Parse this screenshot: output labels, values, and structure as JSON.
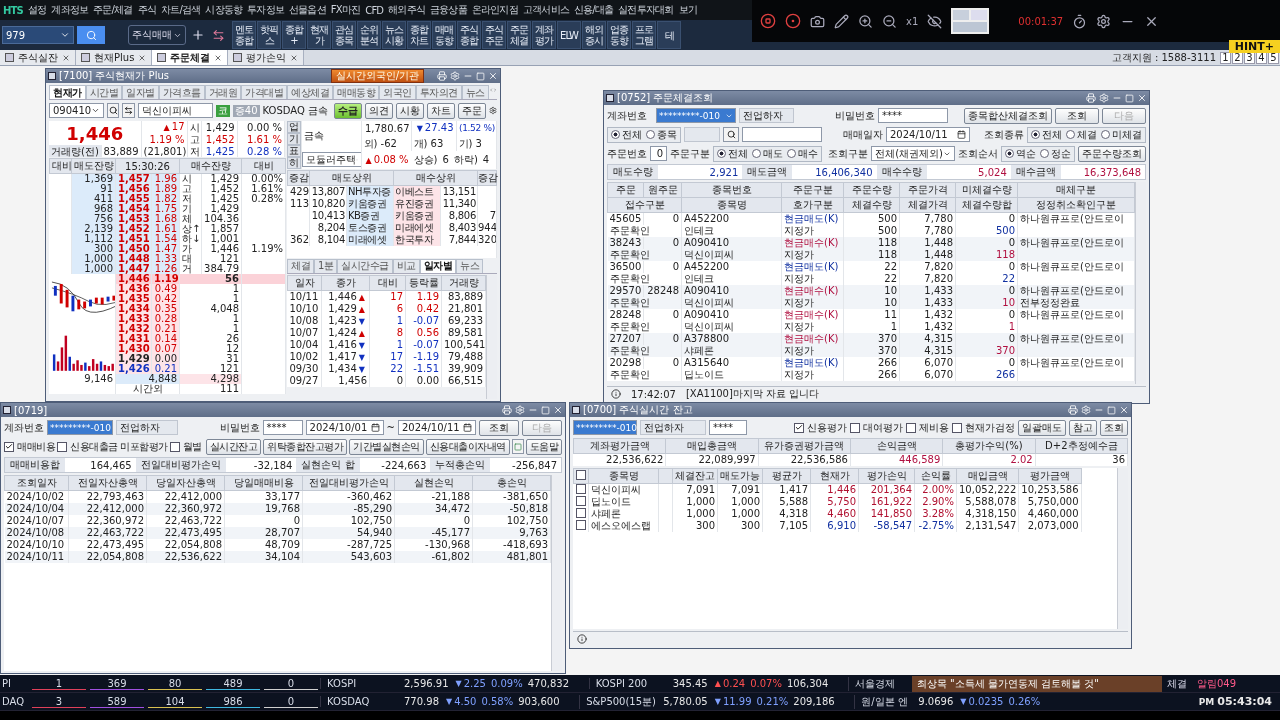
{
  "app": {
    "logo": "HTS"
  },
  "menu": [
    "설정",
    "계좌정보",
    "주문/체결",
    "주식",
    "차트/검색",
    "시장동향",
    "투자정보",
    "선물옵션",
    "FX마진",
    "CFD",
    "해외주식",
    "금융상품",
    "온라인지점",
    "고객서비스",
    "신용/대출",
    "실전투자대회",
    "보기"
  ],
  "recorder": {
    "zoom": "x1",
    "time": "00:01:37",
    "banner": "HINT+"
  },
  "toolbar": {
    "account": "979",
    "screen": "주식매매",
    "buttons": [
      "멘토\n종합",
      "핫픽\n스",
      "종합\n+",
      "현재\n가",
      "관심\n종목",
      "순위\n분석",
      "뉴스\n시황",
      "종합\n차트",
      "매매\n동향",
      "주식\n종합",
      "주식\n주문",
      "주문\n체결",
      "계좌\n평가",
      "ELW",
      "해외\n증시",
      "업종\n동향",
      "프로\n그램",
      "테"
    ]
  },
  "tabs": [
    {
      "label": "주식실잔",
      "selected": false
    },
    {
      "label": "현재Plus",
      "selected": false
    },
    {
      "label": "주문체결",
      "selected": true
    },
    {
      "label": "평가손익",
      "selected": false
    }
  ],
  "support": "고객지원 : 1588-3111",
  "pages": [
    "1",
    "2",
    "3",
    "4",
    "5"
  ],
  "quote_window": {
    "title": "[7100] 주식현재가 Plus",
    "badge": "실시간외국인/기관",
    "tabs": [
      {
        "label": "현재가",
        "selected": true
      },
      {
        "label": "시간별",
        "selected": false
      },
      {
        "label": "일자별",
        "selected": false
      },
      {
        "label": "가격흐름",
        "selected": false
      },
      {
        "label": "거래원",
        "selected": false
      },
      {
        "label": "가격대별",
        "selected": false
      },
      {
        "label": "예상체결",
        "selected": false
      },
      {
        "label": "매매동향",
        "selected": false
      },
      {
        "label": "외국인",
        "selected": false
      },
      {
        "label": "투자의견",
        "selected": false
      },
      {
        "label": "뉴스",
        "selected": false
      }
    ],
    "code": "090410",
    "name": "덕신이피씨",
    "chips": [
      "코",
      "증40"
    ],
    "market": "KOSDAQ 금속",
    "actions": [
      {
        "label": "수급",
        "selected": true
      },
      {
        "label": "의견",
        "selected": false
      },
      {
        "label": "시황",
        "selected": false
      },
      {
        "label": "차트",
        "selected": false
      },
      {
        "label": "주문",
        "selected": false
      }
    ],
    "price": "1,446",
    "arrow": "▲",
    "change": "17",
    "rate": "1.19 %",
    "volume_label": "거래량(전)",
    "volume": "83,889",
    "prev_volume": "(21,801)",
    "summary": [
      {
        "label": "시",
        "value": "1,429",
        "rate": "0.00 %"
      },
      {
        "label": "고",
        "value": "1,452",
        "rate": "1.61 %"
      },
      {
        "label": "저",
        "value": "1,425",
        "rate": "0.28 %"
      }
    ],
    "side_tabs": [
      "업",
      "기",
      "표",
      "히"
    ],
    "sector": {
      "name": "금속",
      "value": "1,780.67",
      "arrow": "▼",
      "change": "27.43",
      "rate": "(1.52 %)",
      "foreign": "외) -62",
      "individual": "개) 63",
      "institution": "기) 3",
      "theme": "모듈러주택",
      "theme_arrow": "▲",
      "theme_rate": "0.08 %",
      "up_label": "상승)",
      "up": "6",
      "down_label": "하락)",
      "down": "4"
    },
    "book_header": [
      "대비",
      "매도잔량",
      "15:30:26",
      "매수잔량",
      "대비"
    ],
    "asks": [
      {
        "qty": "1,369",
        "price": "1,457",
        "pct": "1.96",
        "label": "시",
        "value": "1,429",
        "extra": "0.00%"
      },
      {
        "qty": "91",
        "price": "1,456",
        "pct": "1.89",
        "label": "고",
        "value": "1,452",
        "extra": "1.61%"
      },
      {
        "qty": "411",
        "price": "1,455",
        "pct": "1.82",
        "label": "저",
        "value": "1,425",
        "extra": "0.28%"
      },
      {
        "qty": "968",
        "price": "1,454",
        "pct": "1.75",
        "label": "기",
        "value": "1,429"
      },
      {
        "qty": "756",
        "price": "1,453",
        "pct": "1.68",
        "label": "체",
        "value": "104.36"
      },
      {
        "qty": "2,139",
        "price": "1,452",
        "pct": "1.61",
        "label": "상↑",
        "value": "1,857"
      },
      {
        "qty": "1,112",
        "price": "1,451",
        "pct": "1.54",
        "label": "하↓",
        "value": "1,001"
      },
      {
        "qty": "300",
        "price": "1,450",
        "pct": "1.47",
        "label": "가",
        "value": "1,446",
        "extra": "1.19%"
      },
      {
        "qty": "1,000",
        "price": "1,448",
        "pct": "1.33",
        "label": "대",
        "value": "121"
      },
      {
        "qty": "1,000",
        "price": "1,447",
        "pct": "1.26",
        "label": "거",
        "value": "384.79"
      }
    ],
    "bids": [
      {
        "price": "1,446",
        "pct": "1.19",
        "color": "#d00000",
        "qty": "56",
        "selected": true
      },
      {
        "price": "1,436",
        "pct": "0.49",
        "color": "#d00000",
        "qty": "1",
        "selected": false
      },
      {
        "price": "1,435",
        "pct": "0.42",
        "color": "#d00000",
        "qty": "1",
        "selected": false
      },
      {
        "price": "1,434",
        "pct": "0.35",
        "color": "#d00000",
        "qty": "4,048",
        "selected": false
      },
      {
        "price": "1,433",
        "pct": "0.28",
        "color": "#d00000",
        "qty": "1",
        "selected": false
      },
      {
        "price": "1,432",
        "pct": "0.21",
        "color": "#d00000",
        "qty": "1",
        "selected": false
      },
      {
        "price": "1,431",
        "pct": "0.14",
        "color": "#d00000",
        "qty": "26",
        "selected": false
      },
      {
        "price": "1,430",
        "pct": "0.07",
        "color": "#d00000",
        "qty": "12",
        "selected": false
      },
      {
        "price": "1,429",
        "pct": "0.00",
        "color": "#222222",
        "qty": "31",
        "selected": false
      },
      {
        "price": "1,426",
        "pct": "0.21",
        "color": "#1030c0",
        "qty": "121",
        "selected": false
      }
    ],
    "book_total": {
      "ask": "9,146",
      "mid": "4,848",
      "bid": "4,298",
      "after_label": "시간외",
      "after": "111"
    },
    "broker_header": [
      "증감",
      "매도상위",
      "매수상위",
      "증감"
    ],
    "brokers": [
      {
        "sell_change": "429",
        "sell_qty": "13,807",
        "seller": "NH투자증",
        "buyer": "이베스트",
        "buy_qty": "13,151"
      },
      {
        "sell_change": "113",
        "sell_qty": "10,820",
        "seller": "키움증권",
        "buyer": "유진증권",
        "buy_qty": "11,340"
      },
      {
        "sell_qty": "10,413",
        "seller": "KB증권",
        "buyer": "키움증권",
        "buy_qty": "8,806",
        "buy_change": "7"
      },
      {
        "sell_qty": "8,204",
        "seller": "토스증권",
        "buyer": "미래에셋",
        "buy_qty": "8,403",
        "buy_change": "944"
      },
      {
        "sell_change": "362",
        "sell_qty": "8,104",
        "seller": "미래에셋",
        "buyer": "한국투자",
        "buy_qty": "7,844",
        "buy_change": "320"
      }
    ],
    "sub_tabs": [
      {
        "label": "체결",
        "selected": false
      },
      {
        "label": "1분",
        "selected": false
      },
      {
        "label": "실시간수급",
        "selected": false
      },
      {
        "label": "비교",
        "selected": false
      },
      {
        "label": "일자별",
        "selected": true
      },
      {
        "label": "뉴스",
        "selected": false
      }
    ],
    "daily_columns": [
      "일자",
      "종가",
      "대비",
      "등락률",
      "거래량"
    ],
    "daily": [
      {
        "date": "10/11",
        "close": "1,446",
        "arrow": "▲",
        "color": "#d00000",
        "change": "17",
        "rate": "1.19",
        "volume": "83,889"
      },
      {
        "date": "10/10",
        "close": "1,429",
        "arrow": "▲",
        "color": "#d00000",
        "change": "6",
        "rate": "0.42",
        "volume": "21,801"
      },
      {
        "date": "10/08",
        "close": "1,423",
        "arrow": "▼",
        "color": "#1030c0",
        "change": "1",
        "rate": "-0.07",
        "volume": "69,233"
      },
      {
        "date": "10/07",
        "close": "1,424",
        "arrow": "▲",
        "color": "#d00000",
        "change": "8",
        "rate": "0.56",
        "volume": "89,581"
      },
      {
        "date": "10/04",
        "close": "1,416",
        "arrow": "▼",
        "color": "#1030c0",
        "change": "1",
        "rate": "-0.07",
        "volume": "100,541"
      },
      {
        "date": "10/02",
        "close": "1,417",
        "arrow": "▼",
        "color": "#1030c0",
        "change": "17",
        "rate": "-1.19",
        "volume": "79,488"
      },
      {
        "date": "09/30",
        "close": "1,434",
        "arrow": "▼",
        "color": "#1030c0",
        "change": "22",
        "rate": "-1.51",
        "volume": "39,909"
      },
      {
        "date": "09/27",
        "close": "1,456",
        "color": "#222222",
        "change": "0",
        "rate": "0.00",
        "volume": "66,515"
      }
    ]
  },
  "order_window": {
    "title": "[0752] 주문체결조회",
    "account_label": "계좌번호",
    "account": "*********-010",
    "owner": "전업하자",
    "pw_label": "비밀번호",
    "pw": "****",
    "buttons": [
      {
        "label": "종목합산체결조회",
        "disabled": false
      },
      {
        "label": "조회",
        "disabled": false
      },
      {
        "label": "다음",
        "disabled": true
      }
    ],
    "scope": [
      {
        "label": "전체",
        "selected": true
      },
      {
        "label": "종목",
        "selected": false
      }
    ],
    "date_label": "매매일자",
    "date": "2024/10/11",
    "kind_label": "조회종류",
    "kinds": [
      {
        "label": "전체",
        "selected": true
      },
      {
        "label": "체결",
        "selected": false
      },
      {
        "label": "미체결",
        "selected": false
      }
    ],
    "order_no_label": "주문번호",
    "order_no": "0",
    "side_label": "주문구분",
    "sides": [
      {
        "label": "전체",
        "selected": true
      },
      {
        "label": "매도",
        "selected": false
      },
      {
        "label": "매수",
        "selected": false
      }
    ],
    "query_label": "조회구분",
    "query": "전체(채권제외)",
    "sort_label": "조회순서",
    "sorts": [
      {
        "label": "역순",
        "selected": true
      },
      {
        "label": "정순",
        "selected": false
      }
    ],
    "qty_button": "주문수량조회",
    "totals": [
      {
        "label": "매도수량",
        "value": "2,921"
      },
      {
        "label": "매도금액",
        "value": "16,406,340"
      },
      {
        "label": "매수수량",
        "value": "5,024"
      },
      {
        "label": "매수금액",
        "value": "16,373,648"
      }
    ],
    "header1": [
      "주문",
      "원주문",
      "종목번호",
      "주문구분",
      "주문수량",
      "주문가격",
      "미체결수량",
      "매체구분"
    ],
    "header2": [
      "접수구분",
      "종목명",
      "호가구분",
      "체결수량",
      "체결가격",
      "체결수량합",
      "정정취소확인구분"
    ],
    "rows": [
      {
        "order": "45605",
        "orig": "0",
        "code": "A452200",
        "type": "현금매도(K)",
        "color": "#1030a0",
        "qty": "500",
        "price": "7,780",
        "unfilled": "0",
        "media": "하나원큐프로(안드로이",
        "status": "주문확인",
        "name": "인테크",
        "price_type": "지정가",
        "filled": "500",
        "filled_price": "7,780",
        "filled_sum": "500"
      },
      {
        "order": "38243",
        "orig": "0",
        "code": "A090410",
        "type": "현금매수(K)",
        "color": "#b01040",
        "qty": "118",
        "price": "1,448",
        "unfilled": "0",
        "media": "하나원큐프로(안드로이",
        "status": "주문확인",
        "name": "덕신이피씨",
        "price_type": "지정가",
        "filled": "118",
        "filled_price": "1,448",
        "filled_sum": "118"
      },
      {
        "order": "36500",
        "orig": "0",
        "code": "A452200",
        "type": "현금매도(K)",
        "color": "#1030a0",
        "qty": "22",
        "price": "7,820",
        "unfilled": "0",
        "media": "하나원큐프로(안드로이",
        "status": "주문확인",
        "name": "인테크",
        "price_type": "지정가",
        "filled": "22",
        "filled_price": "7,820",
        "filled_sum": "22"
      },
      {
        "order": "29570",
        "orig": "28248",
        "code": "A090410",
        "type": "현금매수(K)",
        "color": "#b01040",
        "qty": "10",
        "price": "1,433",
        "unfilled": "0",
        "media": "하나원큐프로(안드로이",
        "status": "주문확인",
        "name": "덕신이피씨",
        "price_type": "지정가",
        "filled": "10",
        "filled_price": "1,433",
        "filled_sum": "10",
        "modify": "전부정정완료"
      },
      {
        "order": "28248",
        "orig": "0",
        "code": "A090410",
        "type": "현금매수(K)",
        "color": "#b01040",
        "qty": "11",
        "price": "1,432",
        "unfilled": "0",
        "media": "하나원큐프로(안드로이",
        "status": "주문확인",
        "name": "덕신이피씨",
        "price_type": "지정가",
        "filled": "1",
        "filled_price": "1,432",
        "filled_sum": "1"
      },
      {
        "order": "27207",
        "orig": "0",
        "code": "A378800",
        "type": "현금매수(K)",
        "color": "#b01040",
        "qty": "370",
        "price": "4,315",
        "unfilled": "0",
        "media": "하나원큐프로(안드로이",
        "status": "주문확인",
        "name": "샤페론",
        "price_type": "지정가",
        "filled": "370",
        "filled_price": "4,315",
        "filled_sum": "370"
      },
      {
        "order": "20298",
        "orig": "0",
        "code": "A315640",
        "type": "현금매도(K)",
        "color": "#1030a0",
        "qty": "266",
        "price": "6,070",
        "unfilled": "0",
        "media": "하나원큐프로(안드로이",
        "status": "주문확인",
        "name": "딥노이드",
        "price_type": "지정가",
        "filled": "266",
        "filled_price": "6,070",
        "filled_sum": "266"
      }
    ],
    "status_time": "17:42:07",
    "status_message": "[XA1100]마지막 자료 입니다"
  },
  "profit_window": {
    "title": "[0719]",
    "account_label": "계좌번호",
    "account": "*********-010",
    "owner": "전업하자",
    "pw_label": "비밀번호",
    "pw": "****",
    "from": "2024/10/01",
    "tilde": "~",
    "to": "2024/10/11",
    "buttons": [
      {
        "label": "조회",
        "disabled": false
      },
      {
        "label": "다음",
        "disabled": true
      }
    ],
    "checks": [
      {
        "label": "매매비용",
        "checked": true
      },
      {
        "label": "신용대출금 미포함평가",
        "checked": false
      },
      {
        "label": "월별",
        "checked": false
      }
    ],
    "links": [
      "실시간잔고",
      "위탁종합잔고평가",
      "기간별실현손익",
      "신용대출이자내역"
    ],
    "help": "도움말",
    "totals": [
      {
        "label": "매매비용합",
        "value": "164,465"
      },
      {
        "label": "전일대비평가손익",
        "value": "-32,184"
      },
      {
        "label": "실현손익 합",
        "value": "-224,663"
      },
      {
        "label": "누적총손익",
        "value": "-256,847"
      }
    ],
    "columns": [
      "조회일자",
      "전일자산총액",
      "당일자산총액",
      "당일매매비용",
      "전일대비평가손익",
      "실현손익",
      "총손익"
    ],
    "rows": [
      [
        "2024/10/02",
        "22,793,463",
        "22,412,000",
        "33,177",
        "-360,462",
        "-21,188",
        "-381,650"
      ],
      [
        "2024/10/04",
        "22,412,000",
        "22,360,972",
        "19,768",
        "-85,290",
        "34,472",
        "-50,818"
      ],
      [
        "2024/10/07",
        "22,360,972",
        "22,463,722",
        "0",
        "102,750",
        "0",
        "102,750"
      ],
      [
        "2024/10/08",
        "22,463,722",
        "22,473,495",
        "28,707",
        "54,940",
        "-45,177",
        "9,763"
      ],
      [
        "2024/10/10",
        "22,473,495",
        "22,054,808",
        "48,709",
        "-287,725",
        "-130,968",
        "-418,693"
      ],
      [
        "2024/10/11",
        "22,054,808",
        "22,536,622",
        "34,104",
        "543,603",
        "-61,802",
        "481,801"
      ]
    ]
  },
  "balance_window": {
    "title": "[0700] 주식실시간 잔고",
    "account": "*********-010",
    "owner": "전업하자",
    "pw": "****",
    "checks": [
      {
        "label": "신용평가",
        "checked": true
      },
      {
        "label": "대여평가",
        "checked": false
      },
      {
        "label": "제비용",
        "checked": false
      },
      {
        "label": "현재가검정",
        "checked": false
      }
    ],
    "buttons": [
      "일괄매도",
      "참고",
      "조회"
    ],
    "totals": [
      {
        "label": "계좌평가금액",
        "value": "22,536,622"
      },
      {
        "label": "매입총금액",
        "value": "22,089,997"
      },
      {
        "label": "유가증권평가금액",
        "value": "22,536,586"
      },
      {
        "label": "손익금액",
        "value": "446,589"
      },
      {
        "label": "총평가수익(%)",
        "value": "2.02"
      },
      {
        "label": "D+2추정예수금",
        "value": "36"
      }
    ],
    "columns": [
      "종목명",
      "체결잔고",
      "매도가능",
      "평균가",
      "현재가",
      "평가손익",
      "손익률",
      "매입금액",
      "평가금액"
    ],
    "all_checked": false,
    "rows": [
      {
        "checked": false,
        "name": "덕신이피씨",
        "qty": "7,091",
        "sellable": "7,091",
        "avg": "1,417",
        "price": "1,446",
        "color": "#b01030",
        "pl": "201,364",
        "rate": "2.00%",
        "cost": "10,052,222",
        "value": "10,253,586"
      },
      {
        "checked": false,
        "name": "딥노이드",
        "qty": "1,000",
        "sellable": "1,000",
        "avg": "5,588",
        "price": "5,750",
        "color": "#b01030",
        "pl": "161,922",
        "rate": "2.90%",
        "cost": "5,588,078",
        "value": "5,750,000"
      },
      {
        "checked": false,
        "name": "샤페론",
        "qty": "1,000",
        "sellable": "1,000",
        "avg": "4,318",
        "price": "4,460",
        "color": "#b01030",
        "pl": "141,850",
        "rate": "3.28%",
        "cost": "4,318,150",
        "value": "4,460,000"
      },
      {
        "checked": false,
        "name": "에스오에스랩",
        "qty": "300",
        "sellable": "300",
        "avg": "7,105",
        "price": "6,910",
        "color": "#1030a0",
        "pl": "-58,547",
        "rate": "-2.75%",
        "cost": "2,131,547",
        "value": "2,073,000"
      }
    ]
  },
  "ticker": {
    "rows": [
      {
        "market": "PI",
        "counts": [
          {
            "value": "1",
            "color": "#e0405a"
          },
          {
            "value": "369",
            "color": "#a050e0"
          },
          {
            "value": "80",
            "color": "#d8c050"
          },
          {
            "value": "489",
            "color": "#40b8e0"
          },
          {
            "value": "0",
            "color": "#d0d0d0"
          }
        ],
        "quotes": [
          {
            "name": "KOSPI",
            "value": "2,596.91",
            "arrow": "▼",
            "color": "#7fa0ff",
            "change": "2.25",
            "rate": "0.09%",
            "volume": "470,832"
          },
          {
            "name": "KOSPI 200",
            "value": "345.45",
            "arrow": "▲",
            "color": "#ff5050",
            "change": "0.24",
            "rate": "0.07%",
            "volume": "106,304"
          }
        ]
      },
      {
        "market": "DAQ",
        "counts": [
          {
            "value": "3",
            "color": "#e0405a"
          },
          {
            "value": "589",
            "color": "#a050e0"
          },
          {
            "value": "104",
            "color": "#d8c050"
          },
          {
            "value": "986",
            "color": "#40b8e0"
          },
          {
            "value": "0",
            "color": "#d0d0d0"
          }
        ],
        "quotes": [
          {
            "name": "KOSDAQ",
            "value": "770.98",
            "arrow": "▼",
            "color": "#7fa0ff",
            "change": "4.50",
            "rate": "0.58%",
            "volume": "903,600"
          },
          {
            "name": "S&P500(15분)",
            "value": "5,780.05",
            "arrow": "▼",
            "color": "#7fa0ff",
            "change": "11.99",
            "rate": "0.21%",
            "volume": "209,186"
          }
        ]
      }
    ],
    "news_source": "서울경제",
    "headline": "최상목 \"소득세 물가연동제 검토해볼 것\"",
    "fx_name": "원/일본 엔",
    "fx_value": "9.0696",
    "fx_arrow": "▼",
    "fx_change": "0.0235",
    "fx_rate": "0.26%",
    "fill_button": "체결",
    "alert_button": "알림049",
    "clock_ampm": "PM",
    "clock": "05:43:04"
  }
}
